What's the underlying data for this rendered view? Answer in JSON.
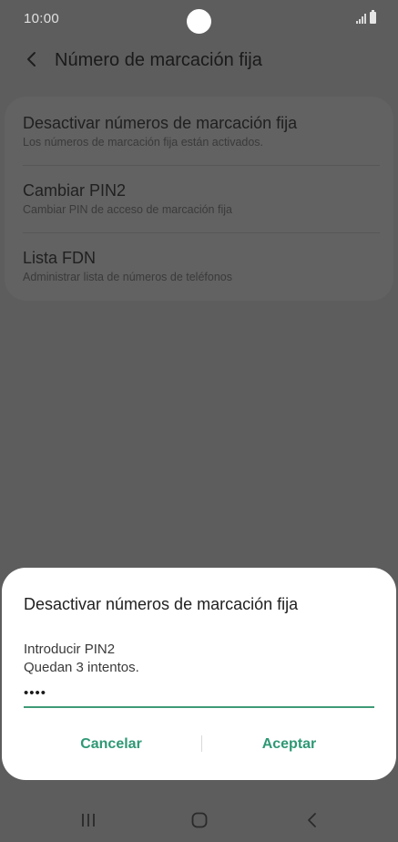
{
  "status_bar": {
    "time": "10:00"
  },
  "header": {
    "title": "Número de marcación fija",
    "back_icon": "chevron-left-icon"
  },
  "settings": {
    "items": [
      {
        "title": "Desactivar números de marcación fija",
        "subtitle": "Los números de marcación fija están activados."
      },
      {
        "title": "Cambiar PIN2",
        "subtitle": "Cambiar PIN de acceso de marcación fija"
      },
      {
        "title": "Lista FDN",
        "subtitle": "Administrar lista de números de teléfonos"
      }
    ]
  },
  "dialog": {
    "title": "Desactivar números de marcación fija",
    "message_line1": "Introducir PIN2",
    "message_line2": "Quedan 3 intentos.",
    "pin_value": "••••",
    "cancel_label": "Cancelar",
    "accept_label": "Aceptar",
    "accent_color": "#2f9875"
  },
  "nav_bar": {
    "icons": [
      "recents-icon",
      "home-icon",
      "back-icon"
    ]
  }
}
